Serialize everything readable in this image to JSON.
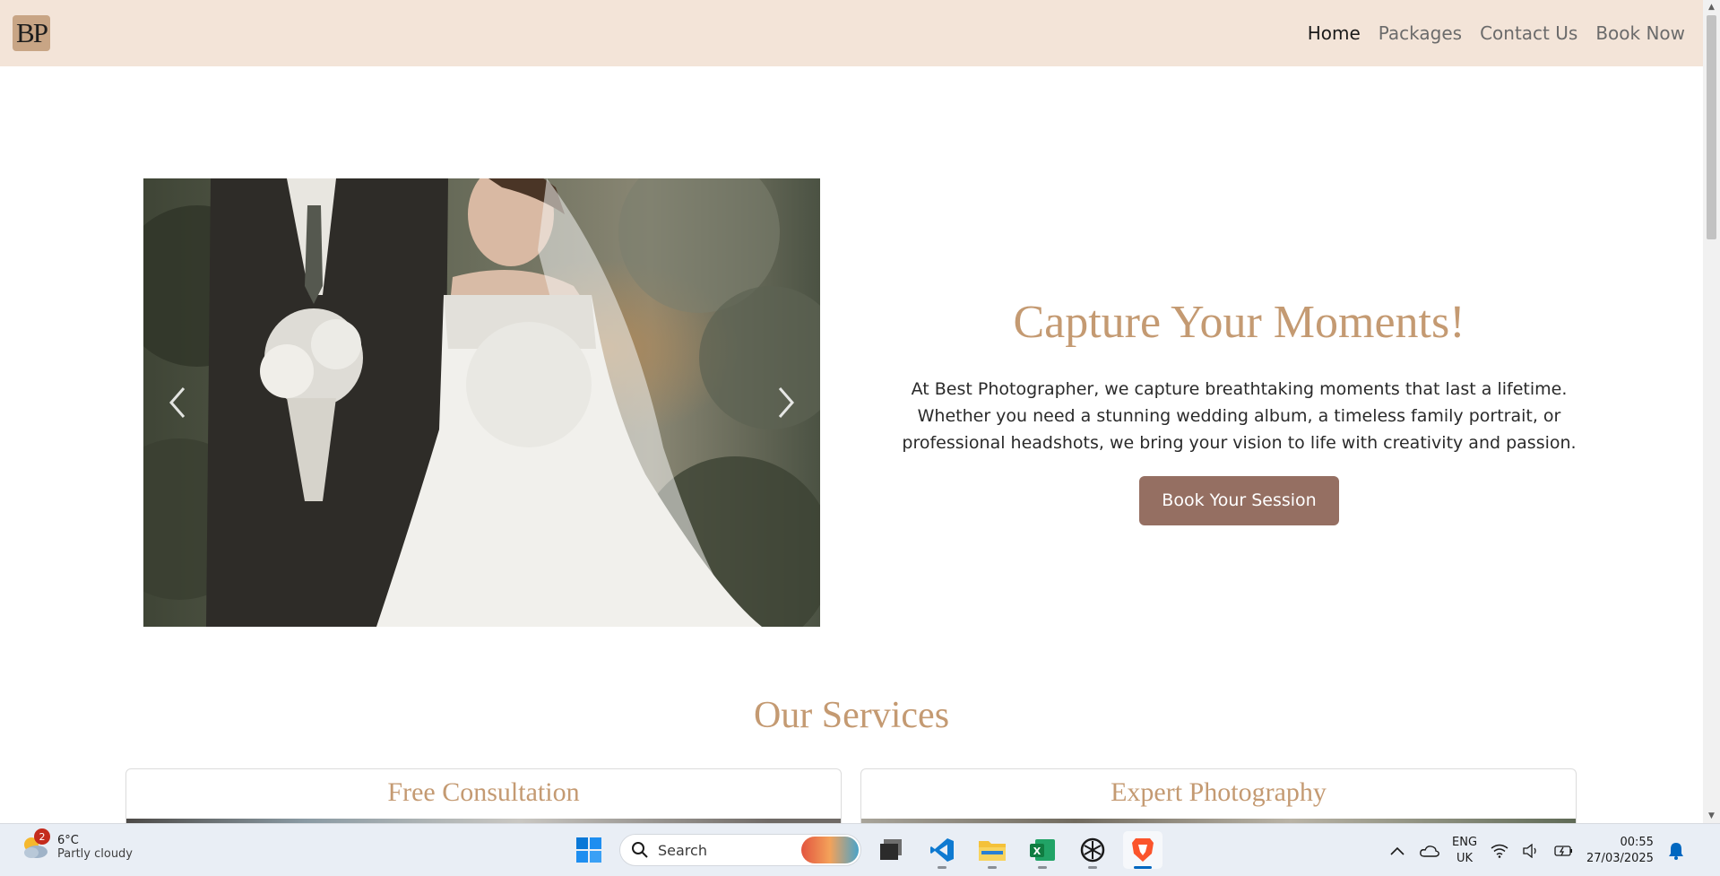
{
  "nav": {
    "logo_text": "BP",
    "links": [
      {
        "label": "Home",
        "active": true
      },
      {
        "label": "Packages",
        "active": false
      },
      {
        "label": "Contact Us",
        "active": false
      },
      {
        "label": "Book Now",
        "active": false
      }
    ]
  },
  "hero": {
    "title": "Capture Your Moments!",
    "description": "At Best Photographer, we capture breathtaking moments that last a lifetime. Whether you need a stunning wedding album, a timeless family portrait, or professional headshots, we bring your vision to life with creativity and passion.",
    "button_label": "Book Your Session",
    "carousel_image": "wedding-couple-photo"
  },
  "services": {
    "title": "Our Services",
    "cards": [
      {
        "title": "Free Consultation"
      },
      {
        "title": "Expert Photography"
      }
    ]
  },
  "taskbar": {
    "weather": {
      "temp": "6°C",
      "condition": "Partly cloudy",
      "badge": "2"
    },
    "search_placeholder": "Search",
    "apps": [
      "file-explorer-icon",
      "vscode-icon",
      "folder-icon",
      "excel-icon",
      "chatgpt-icon",
      "brave-icon"
    ],
    "language": {
      "line1": "ENG",
      "line2": "UK"
    },
    "clock": {
      "time": "00:55",
      "date": "27/03/2025"
    }
  },
  "colors": {
    "nav_bg": "#f3e4d8",
    "accent_gold": "#c49a72",
    "button_brown": "#956f62"
  }
}
